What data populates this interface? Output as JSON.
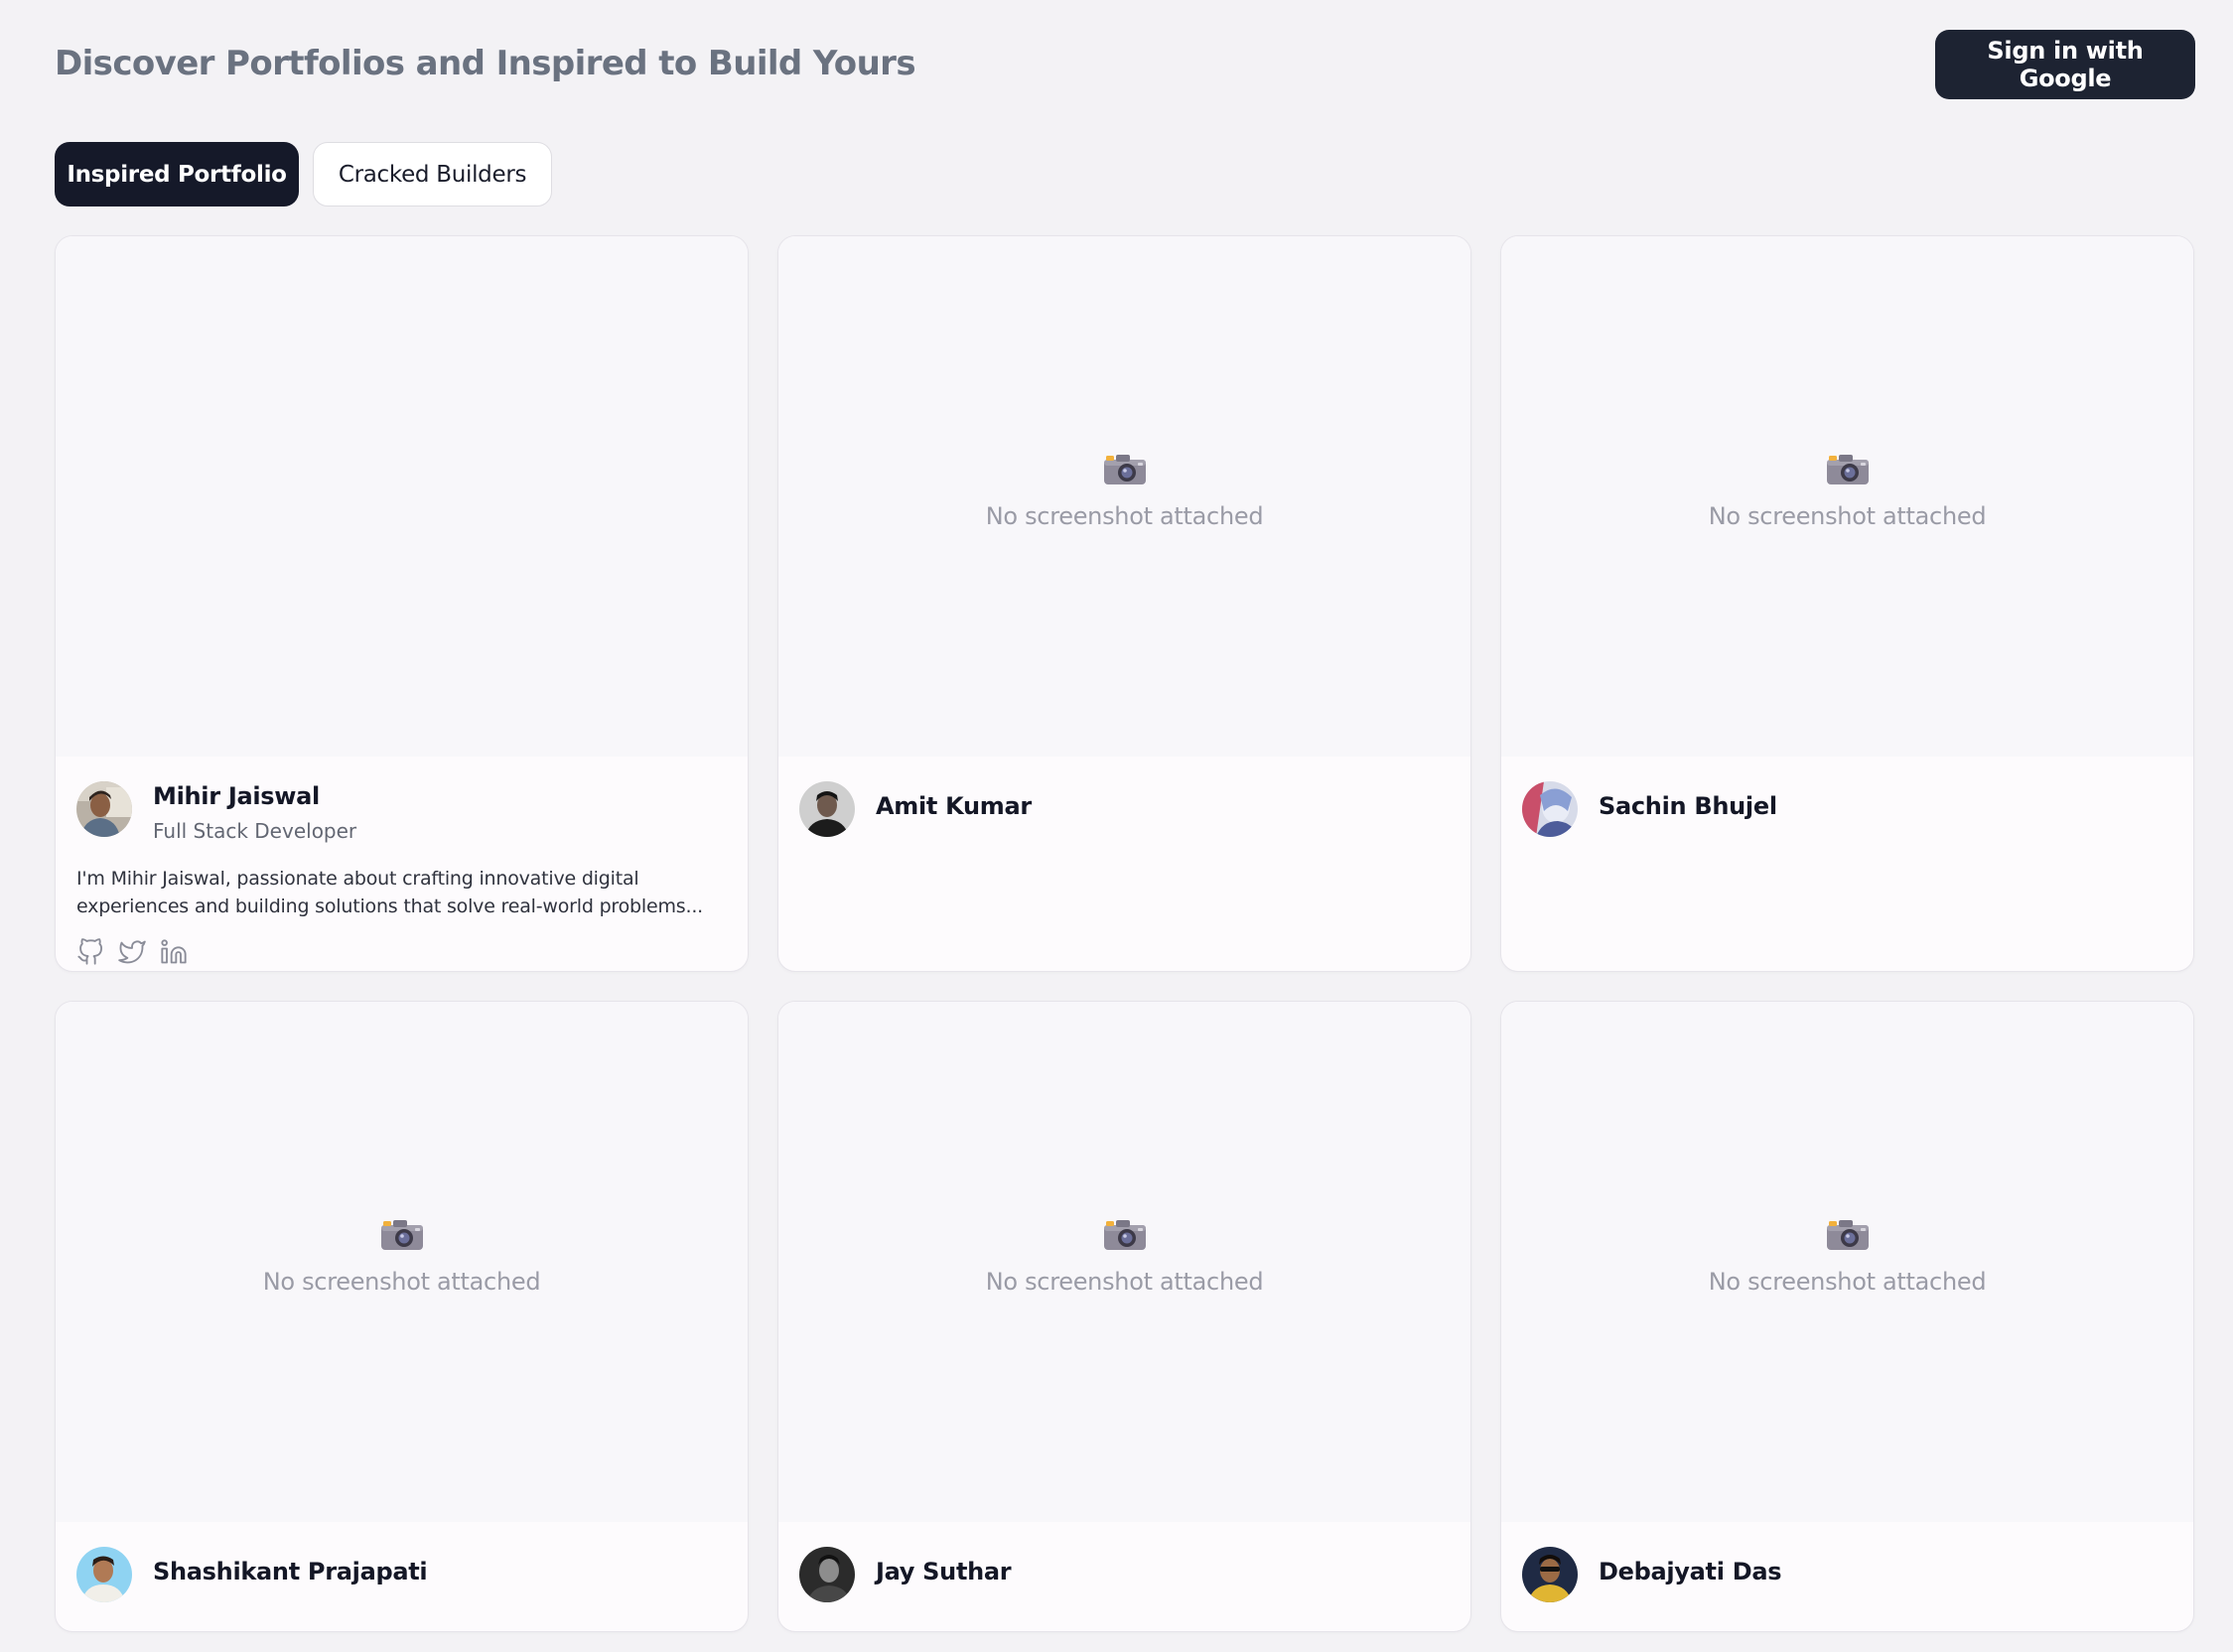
{
  "header": {
    "title": "Discover Portfolios and Inspired to Build Yours",
    "signin_label": "Sign in with Google"
  },
  "tabs": [
    {
      "label": "Inspired Portfolio",
      "active": true
    },
    {
      "label": "Cracked Builders",
      "active": false
    }
  ],
  "cards": [
    {
      "name": "Mihir Jaiswal",
      "role": "Full Stack Developer",
      "bio": "I'm Mihir Jaiswal, passionate about crafting innovative digital experiences and building solutions that solve real-world problems...",
      "social_icons": [
        "github-icon",
        "twitter-icon",
        "linkedin-icon"
      ]
    },
    {
      "name": "Amit Kumar",
      "placeholder": "No screenshot attached"
    },
    {
      "name": "Sachin Bhujel",
      "placeholder": "No screenshot attached"
    },
    {
      "name": "Shashikant Prajapati",
      "placeholder": "No screenshot attached"
    },
    {
      "name": "Jay Suthar",
      "placeholder": "No screenshot attached"
    },
    {
      "name": "Debajyati Das",
      "placeholder": "No screenshot attached"
    }
  ],
  "icons": {
    "placeholder_icon": "camera-icon"
  },
  "colors": {
    "background": "#f3f2f5",
    "primary_dark": "#1d2332",
    "title_gray": "#6a7280",
    "card_background": "#fdfbfd",
    "placeholder_text": "#9a9ba6"
  }
}
